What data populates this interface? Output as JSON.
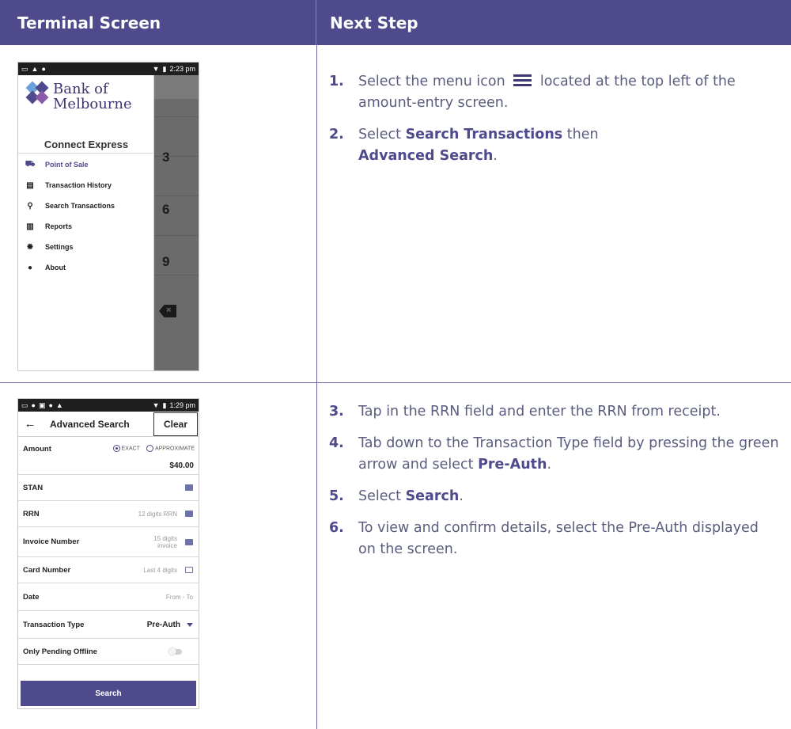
{
  "header": {
    "left_title": "Terminal Screen",
    "right_title": "Next Step"
  },
  "colors": {
    "header_bg": "#4f4a8c",
    "accent": "#4f4a8c",
    "body_text": "#5a5d7e"
  },
  "screen1": {
    "status_time": "2:23 pm",
    "bank_line1": "Bank of",
    "bank_line2": "Melbourne",
    "title": "Connect Express",
    "menu": [
      {
        "label": "Point of Sale",
        "icon": "cart-icon"
      },
      {
        "label": "Transaction History",
        "icon": "receipt-icon"
      },
      {
        "label": "Search Transactions",
        "icon": "search-icon"
      },
      {
        "label": "Reports",
        "icon": "chart-icon"
      },
      {
        "label": "Settings",
        "icon": "gear-icon"
      },
      {
        "label": "About",
        "icon": "info-icon"
      }
    ],
    "keys": [
      "3",
      "6",
      "9"
    ]
  },
  "screen2": {
    "status_time": "1:29 pm",
    "title": "Advanced Search",
    "clear_label": "Clear",
    "amount_label": "Amount",
    "exact_label": "EXACT",
    "approx_label": "APPROXIMATE",
    "amount_value": "$40.00",
    "stan_label": "STAN",
    "rrn_label": "RRN",
    "rrn_placeholder": "12 digits RRN",
    "invoice_label": "Invoice Number",
    "invoice_placeholder_1": "15 digits",
    "invoice_placeholder_2": "invoice",
    "card_label": "Card Number",
    "card_placeholder": "Last 4 digits",
    "date_label": "Date",
    "date_placeholder": "From - To",
    "type_label": "Transaction Type",
    "type_value": "Pre-Auth",
    "pending_label": "Only Pending Offline",
    "search_label": "Search"
  },
  "steps": {
    "s1_num": "1.",
    "s1_a": "Select the menu icon",
    "s1_b": "located at the top left of the amount-entry screen.",
    "s2_num": "2.",
    "s2_a": "Select",
    "s2_b1": "Search Transactions",
    "s2_c": "then",
    "s2_b2": "Advanced Search",
    "s2_d": ".",
    "s3_num": "3.",
    "s3_text": "Tap in the RRN field and enter the RRN from receipt.",
    "s4_num": "4.",
    "s4_a": "Tab down to the Transaction Type field by pressing the green arrow and select",
    "s4_b": "Pre-Auth",
    "s4_c": ".",
    "s5_num": "5.",
    "s5_a": "Select",
    "s5_b": "Search",
    "s5_c": ".",
    "s6_num": "6.",
    "s6_text": "To view and confirm details, select the Pre-Auth displayed on the screen."
  }
}
